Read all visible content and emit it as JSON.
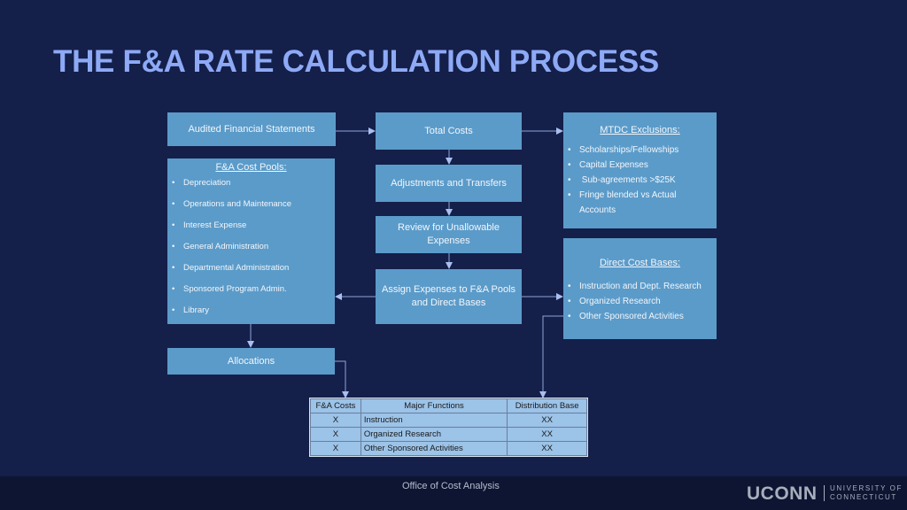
{
  "title": "THE F&A RATE CALCULATION PROCESS",
  "boxes": {
    "audited": "Audited Financial Statements",
    "total_costs": "Total Costs",
    "adjustments": "Adjustments and Transfers",
    "review_line1": "Review for Unallowable",
    "review_line2": "Expenses",
    "assign_line1": "Assign Expenses to F&A Pools",
    "assign_line2": "and Direct Bases",
    "allocations": "Allocations"
  },
  "pools": {
    "heading": "F&A Cost Pools:",
    "items": [
      "Depreciation",
      "Operations and Maintenance",
      "Interest Expense",
      "General Administration",
      "Departmental Administration",
      "Sponsored Program Admin.",
      "Library"
    ]
  },
  "mtdc": {
    "heading": "MTDC Exclusions:",
    "items": [
      "Scholarships/Fellowships",
      "Capital Expenses",
      " Sub-agreements >$25K",
      "Fringe blended vs Actual"
    ],
    "continuation": "Accounts"
  },
  "bases": {
    "heading": "Direct Cost Bases:",
    "items": [
      "Instruction and Dept. Research",
      "Organized Research",
      "Other Sponsored Activities"
    ]
  },
  "table": {
    "headers": [
      "F&A Costs",
      "Major Functions",
      "Distribution Base"
    ],
    "rows": [
      [
        "X",
        "Instruction",
        "XX"
      ],
      [
        "X",
        "Organized Research",
        "XX"
      ],
      [
        "X",
        "Other Sponsored Activities",
        "XX"
      ]
    ]
  },
  "footer": {
    "office": "Office of Cost Analysis",
    "logo": "UCONN",
    "logo_sub_line1": "UNIVERSITY OF",
    "logo_sub_line2": "CONNECTICUT"
  }
}
